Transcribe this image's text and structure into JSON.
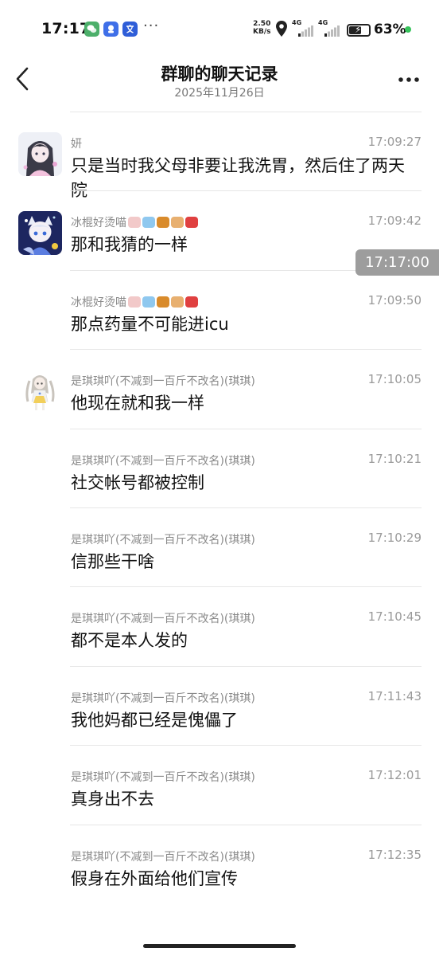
{
  "status_bar": {
    "time": "17:17",
    "more": "···",
    "speed_value": "2.50",
    "speed_unit": "KB/s",
    "sim1_label": "4G",
    "sim2_label": "4G",
    "battery_percent": "63%",
    "battery_level": 0.63,
    "app_icon_colors": [
      "#4caf6a",
      "#3f6fe8",
      "#2f5ed8"
    ],
    "status_dot_color": "#36c35b"
  },
  "header": {
    "title": "群聊的聊天记录",
    "date": "2025年11月26日"
  },
  "floating_time": "17:17:00",
  "messages": [
    {
      "sender": "妍",
      "emojis": [],
      "time": "17:09:27",
      "text": "只是当时我父母非要让我洗胃，然后住了两天院",
      "avatar": "avatar-girl"
    },
    {
      "sender": "冰棍好烫喵",
      "emojis": [
        "dango",
        "ice",
        "burger",
        "noodle",
        "pill"
      ],
      "time": "17:09:42",
      "text": "那和我猜的一样",
      "avatar": "avatar-anime"
    },
    {
      "sender": "冰棍好烫喵",
      "emojis": [
        "dango",
        "ice",
        "burger",
        "noodle",
        "pill"
      ],
      "time": "17:09:50",
      "text": "那点药量不可能进icu",
      "avatar": null
    },
    {
      "sender": "是琪琪吖(不减到一百斤不改名)(琪琪)",
      "emojis": [],
      "time": "17:10:05",
      "text": "他现在就和我一样",
      "avatar": "avatar-chibi"
    },
    {
      "sender": "是琪琪吖(不减到一百斤不改名)(琪琪)",
      "emojis": [],
      "time": "17:10:21",
      "text": "社交帐号都被控制",
      "avatar": null
    },
    {
      "sender": "是琪琪吖(不减到一百斤不改名)(琪琪)",
      "emojis": [],
      "time": "17:10:29",
      "text": "信那些干啥",
      "avatar": null
    },
    {
      "sender": "是琪琪吖(不减到一百斤不改名)(琪琪)",
      "emojis": [],
      "time": "17:10:45",
      "text": "都不是本人发的",
      "avatar": null
    },
    {
      "sender": "是琪琪吖(不减到一百斤不改名)(琪琪)",
      "emojis": [],
      "time": "17:11:43",
      "text": "我他妈都已经是傀儡了",
      "avatar": null
    },
    {
      "sender": "是琪琪吖(不减到一百斤不改名)(琪琪)",
      "emojis": [],
      "time": "17:12:01",
      "text": "真身出不去",
      "avatar": null
    },
    {
      "sender": "是琪琪吖(不减到一百斤不改名)(琪琪)",
      "emojis": [],
      "time": "17:12:35",
      "text": "假身在外面给他们宣传",
      "avatar": null
    }
  ],
  "emoji_colors": {
    "dango": "#f2c9c9",
    "ice": "#8fc8ef",
    "burger": "#d98b2b",
    "noodle": "#e8b070",
    "pill": "#e04040"
  }
}
